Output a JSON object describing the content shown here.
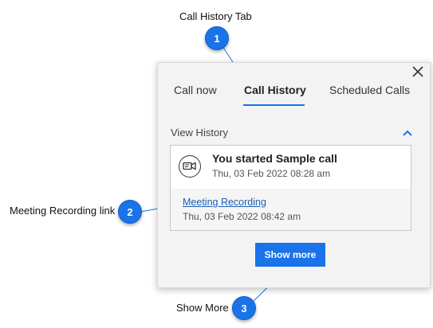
{
  "annotations": [
    {
      "number": "1",
      "label": "Call History Tab"
    },
    {
      "number": "2",
      "label": "Meeting Recording link"
    },
    {
      "number": "3",
      "label": "Show More"
    }
  ],
  "panel": {
    "close_icon": "close-icon",
    "tabs": [
      {
        "label": "Call now",
        "active": false
      },
      {
        "label": "Call History",
        "active": true
      },
      {
        "label": "Scheduled Calls",
        "active": false
      }
    ],
    "section_title": "View History",
    "history": [
      {
        "title": "You started Sample call",
        "time": "Thu, 03 Feb 2022 08:28 am",
        "recording": {
          "link_label": "Meeting Recording",
          "time": "Thu, 03 Feb 2022 08:42 am"
        }
      }
    ],
    "show_more_label": "Show more"
  },
  "colors": {
    "accent": "#1a73e8",
    "badge": "#1a73e8",
    "link": "#1a5fb4",
    "panel_bg": "#f3f3f3"
  }
}
